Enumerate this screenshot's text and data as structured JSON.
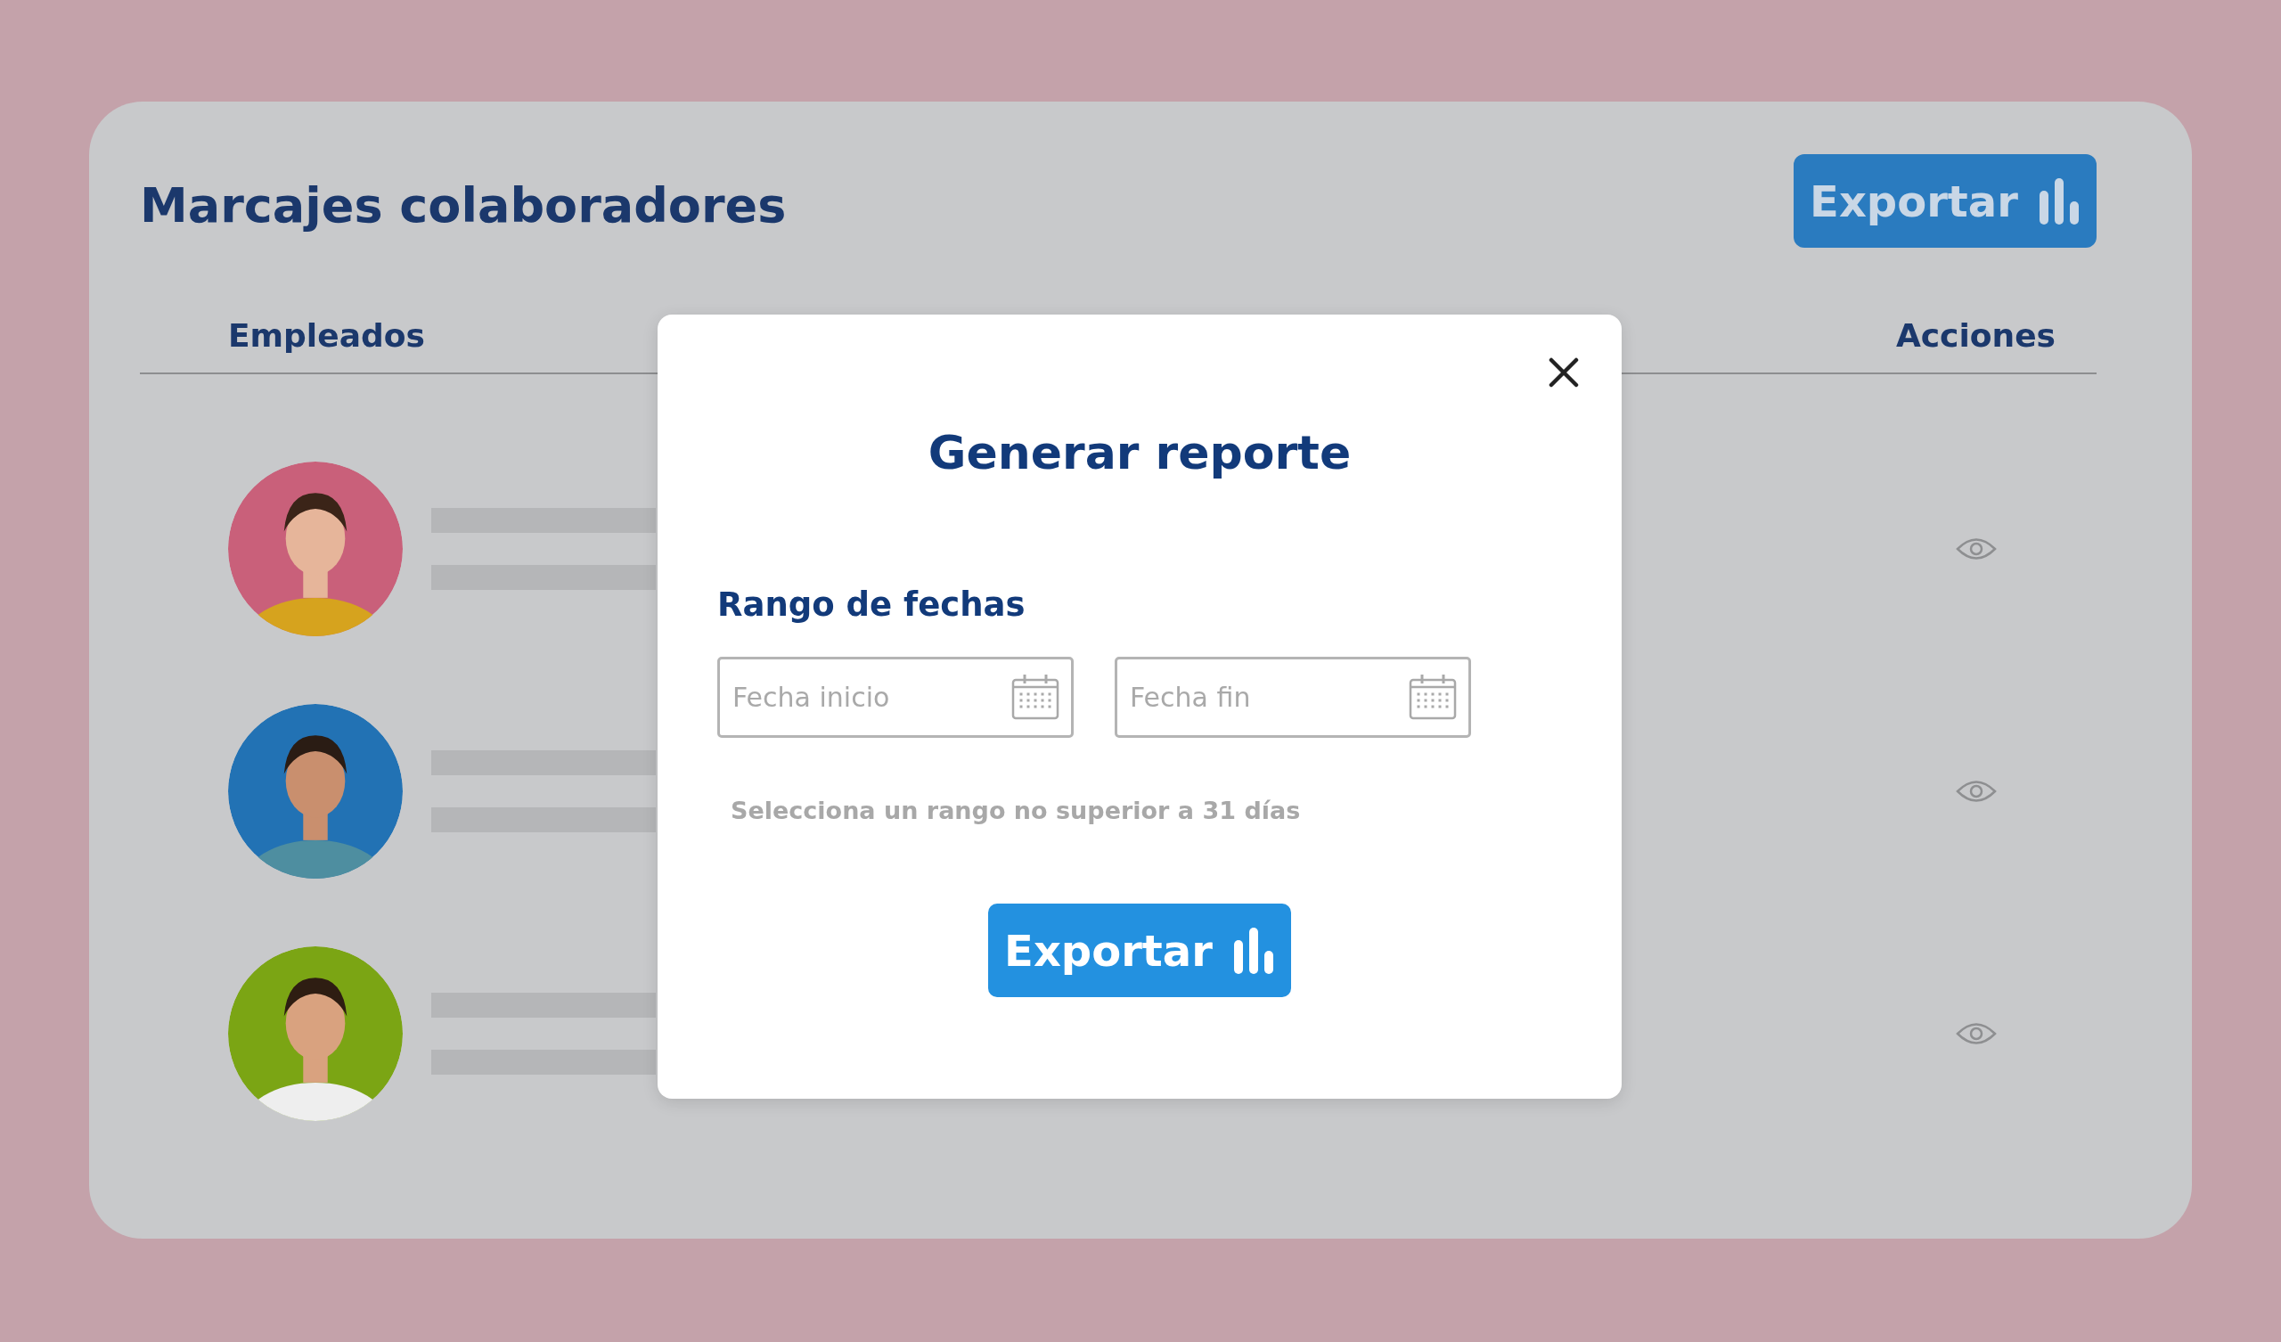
{
  "page": {
    "title": "Marcajes colaboradores",
    "export_button": "Exportar"
  },
  "table": {
    "columns": [
      "Empleados",
      "Acciones"
    ],
    "rows": [
      {
        "color": "#c9607a"
      },
      {
        "color": "#2272b4"
      },
      {
        "color": "#7ba514"
      }
    ]
  },
  "modal": {
    "title": "Generar reporte",
    "section_label": "Rango de fechas",
    "fields": [
      {
        "placeholder": "Fecha inicio"
      },
      {
        "placeholder": "Fecha fin"
      }
    ],
    "hint": "Selecciona un rango no superior a 31 días",
    "button": "Exportar"
  }
}
